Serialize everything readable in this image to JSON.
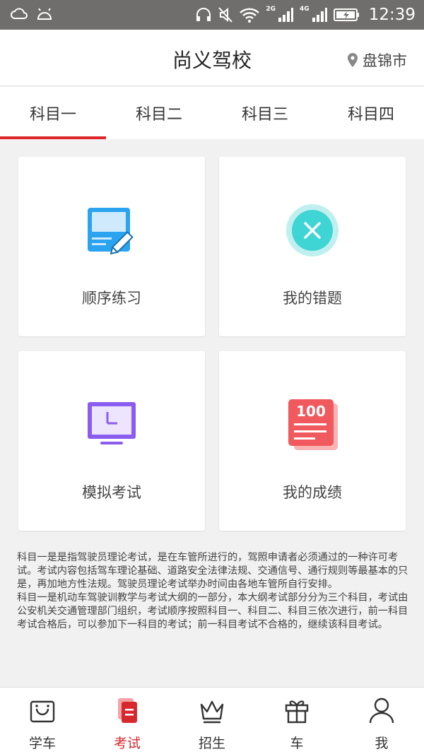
{
  "status_bar": {
    "net_2g": "2G",
    "net_4g": "4G",
    "time": "12:39"
  },
  "header": {
    "title": "尚义驾校",
    "city": "盘锦市"
  },
  "tabs": [
    {
      "label": "科目一",
      "active": true
    },
    {
      "label": "科目二",
      "active": false
    },
    {
      "label": "科目三",
      "active": false
    },
    {
      "label": "科目四",
      "active": false
    }
  ],
  "cards": {
    "order_practice": {
      "label": "顺序练习",
      "icon": "notebook-pencil-icon"
    },
    "my_mistakes": {
      "label": "我的错题",
      "icon": "x-circle-icon"
    },
    "mock_exam": {
      "label": "模拟考试",
      "icon": "monitor-clock-icon"
    },
    "my_scores": {
      "label": "我的成绩",
      "icon": "score-sheet-icon",
      "badge": "100"
    }
  },
  "description": {
    "p1": "科目一是是指驾驶员理论考试，是在车管所进行的，驾照申请者必须通过的一种许可考试。考试内容包括驾车理论基础、道路安全法律法规、交通信号、通行规则等最基本的只是，再加地方性法规。驾驶员理论考试举办时间由各地车管所自行安排。",
    "p2": "科目一是机动车驾驶训教学与考试大纲的一部分，本大纲考试部分分为三个科目，考试由公安机关交通管理部门组织，考试顺序按照科目一、科目二、科目三依次进行，前一科目考试合格后，可以参加下一科目的考试；前一科目考试不合格的，继续该科目考试。"
  },
  "bottom_nav": [
    {
      "label": "学车",
      "icon": "shopping-bag-icon",
      "active": false
    },
    {
      "label": "考试",
      "icon": "exam-papers-icon",
      "active": true
    },
    {
      "label": "招生",
      "icon": "crown-icon",
      "active": false
    },
    {
      "label": "车",
      "icon": "gift-box-icon",
      "active": false
    },
    {
      "label": "我",
      "icon": "person-icon",
      "active": false
    }
  ],
  "colors": {
    "accent": "#e0262b",
    "status_bar": "#6f6e6c",
    "icon_blue": "#2aa4f0",
    "icon_teal": "#3fd5d5",
    "icon_purple": "#8b5cf0",
    "icon_red": "#f05a5f"
  }
}
